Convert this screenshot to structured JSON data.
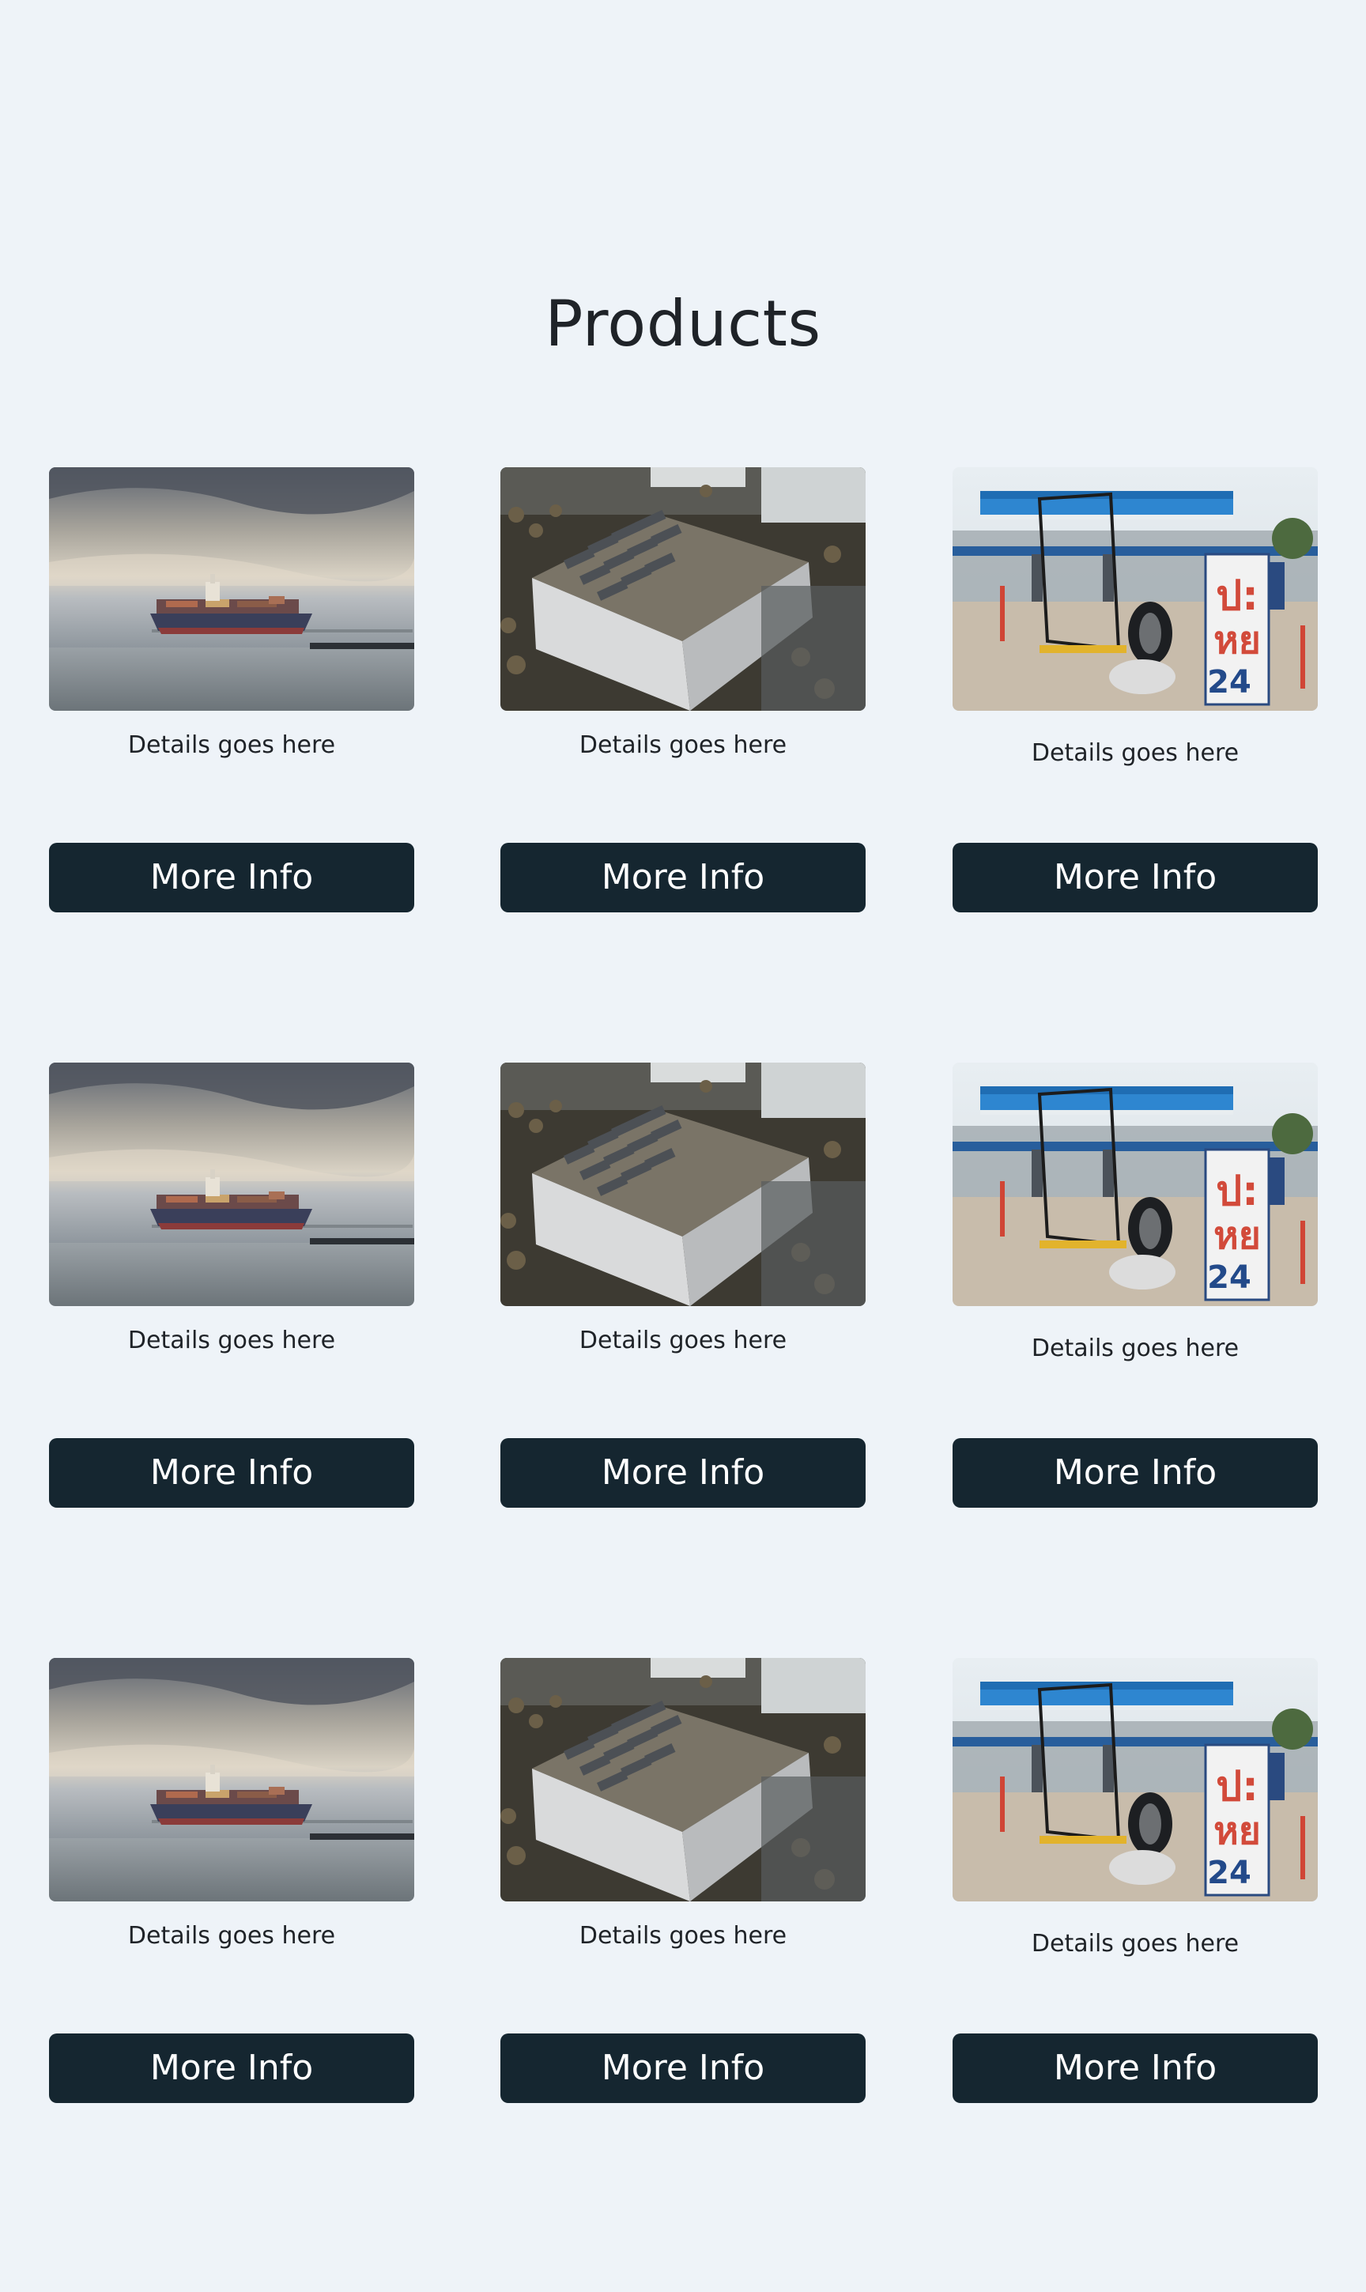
{
  "page": {
    "title": "Products"
  },
  "products": [
    {
      "image": "container-ship-photo",
      "details": "Details goes here",
      "button": "More Info"
    },
    {
      "image": "aerial-rooftop-photo",
      "details": "Details goes here",
      "button": "More Info"
    },
    {
      "image": "gas-station-photo",
      "details": "Details goes here",
      "button": "More Info"
    },
    {
      "image": "container-ship-photo",
      "details": "Details goes here",
      "button": "More Info"
    },
    {
      "image": "aerial-rooftop-photo",
      "details": "Details goes here",
      "button": "More Info"
    },
    {
      "image": "gas-station-photo",
      "details": "Details goes here",
      "button": "More Info"
    },
    {
      "image": "container-ship-photo",
      "details": "Details goes here",
      "button": "More Info"
    },
    {
      "image": "aerial-rooftop-photo",
      "details": "Details goes here",
      "button": "More Info"
    },
    {
      "image": "gas-station-photo",
      "details": "Details goes here",
      "button": "More Info"
    }
  ],
  "colors": {
    "background": "#eef3f8",
    "button": "#152630",
    "button_text": "#ffffff",
    "text": "#1f2328"
  }
}
